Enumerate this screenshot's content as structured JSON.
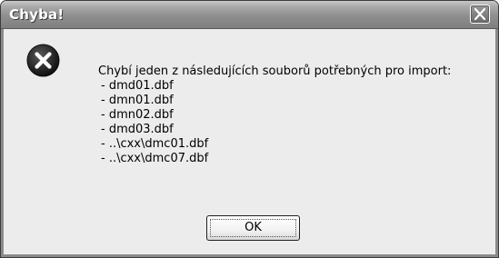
{
  "dialog": {
    "title": "Chyba!",
    "icon": "error-icon",
    "message": {
      "intro": "Chybí jeden z následujících souborů potřebných pro import:",
      "files": [
        "- dmd01.dbf",
        "- dmn01.dbf",
        "- dmn02.dbf",
        "- dmd03.dbf",
        "- ..\\cxx\\dmc01.dbf",
        "- ..\\cxx\\dmc07.dbf"
      ]
    },
    "ok_label": "OK",
    "close_icon": "close-icon"
  },
  "colors": {
    "titlebar": "#8f8f8f",
    "client_bg": "#ececec",
    "error_icon_bg": "#2b2b2b",
    "title_text": "#ffffff"
  }
}
